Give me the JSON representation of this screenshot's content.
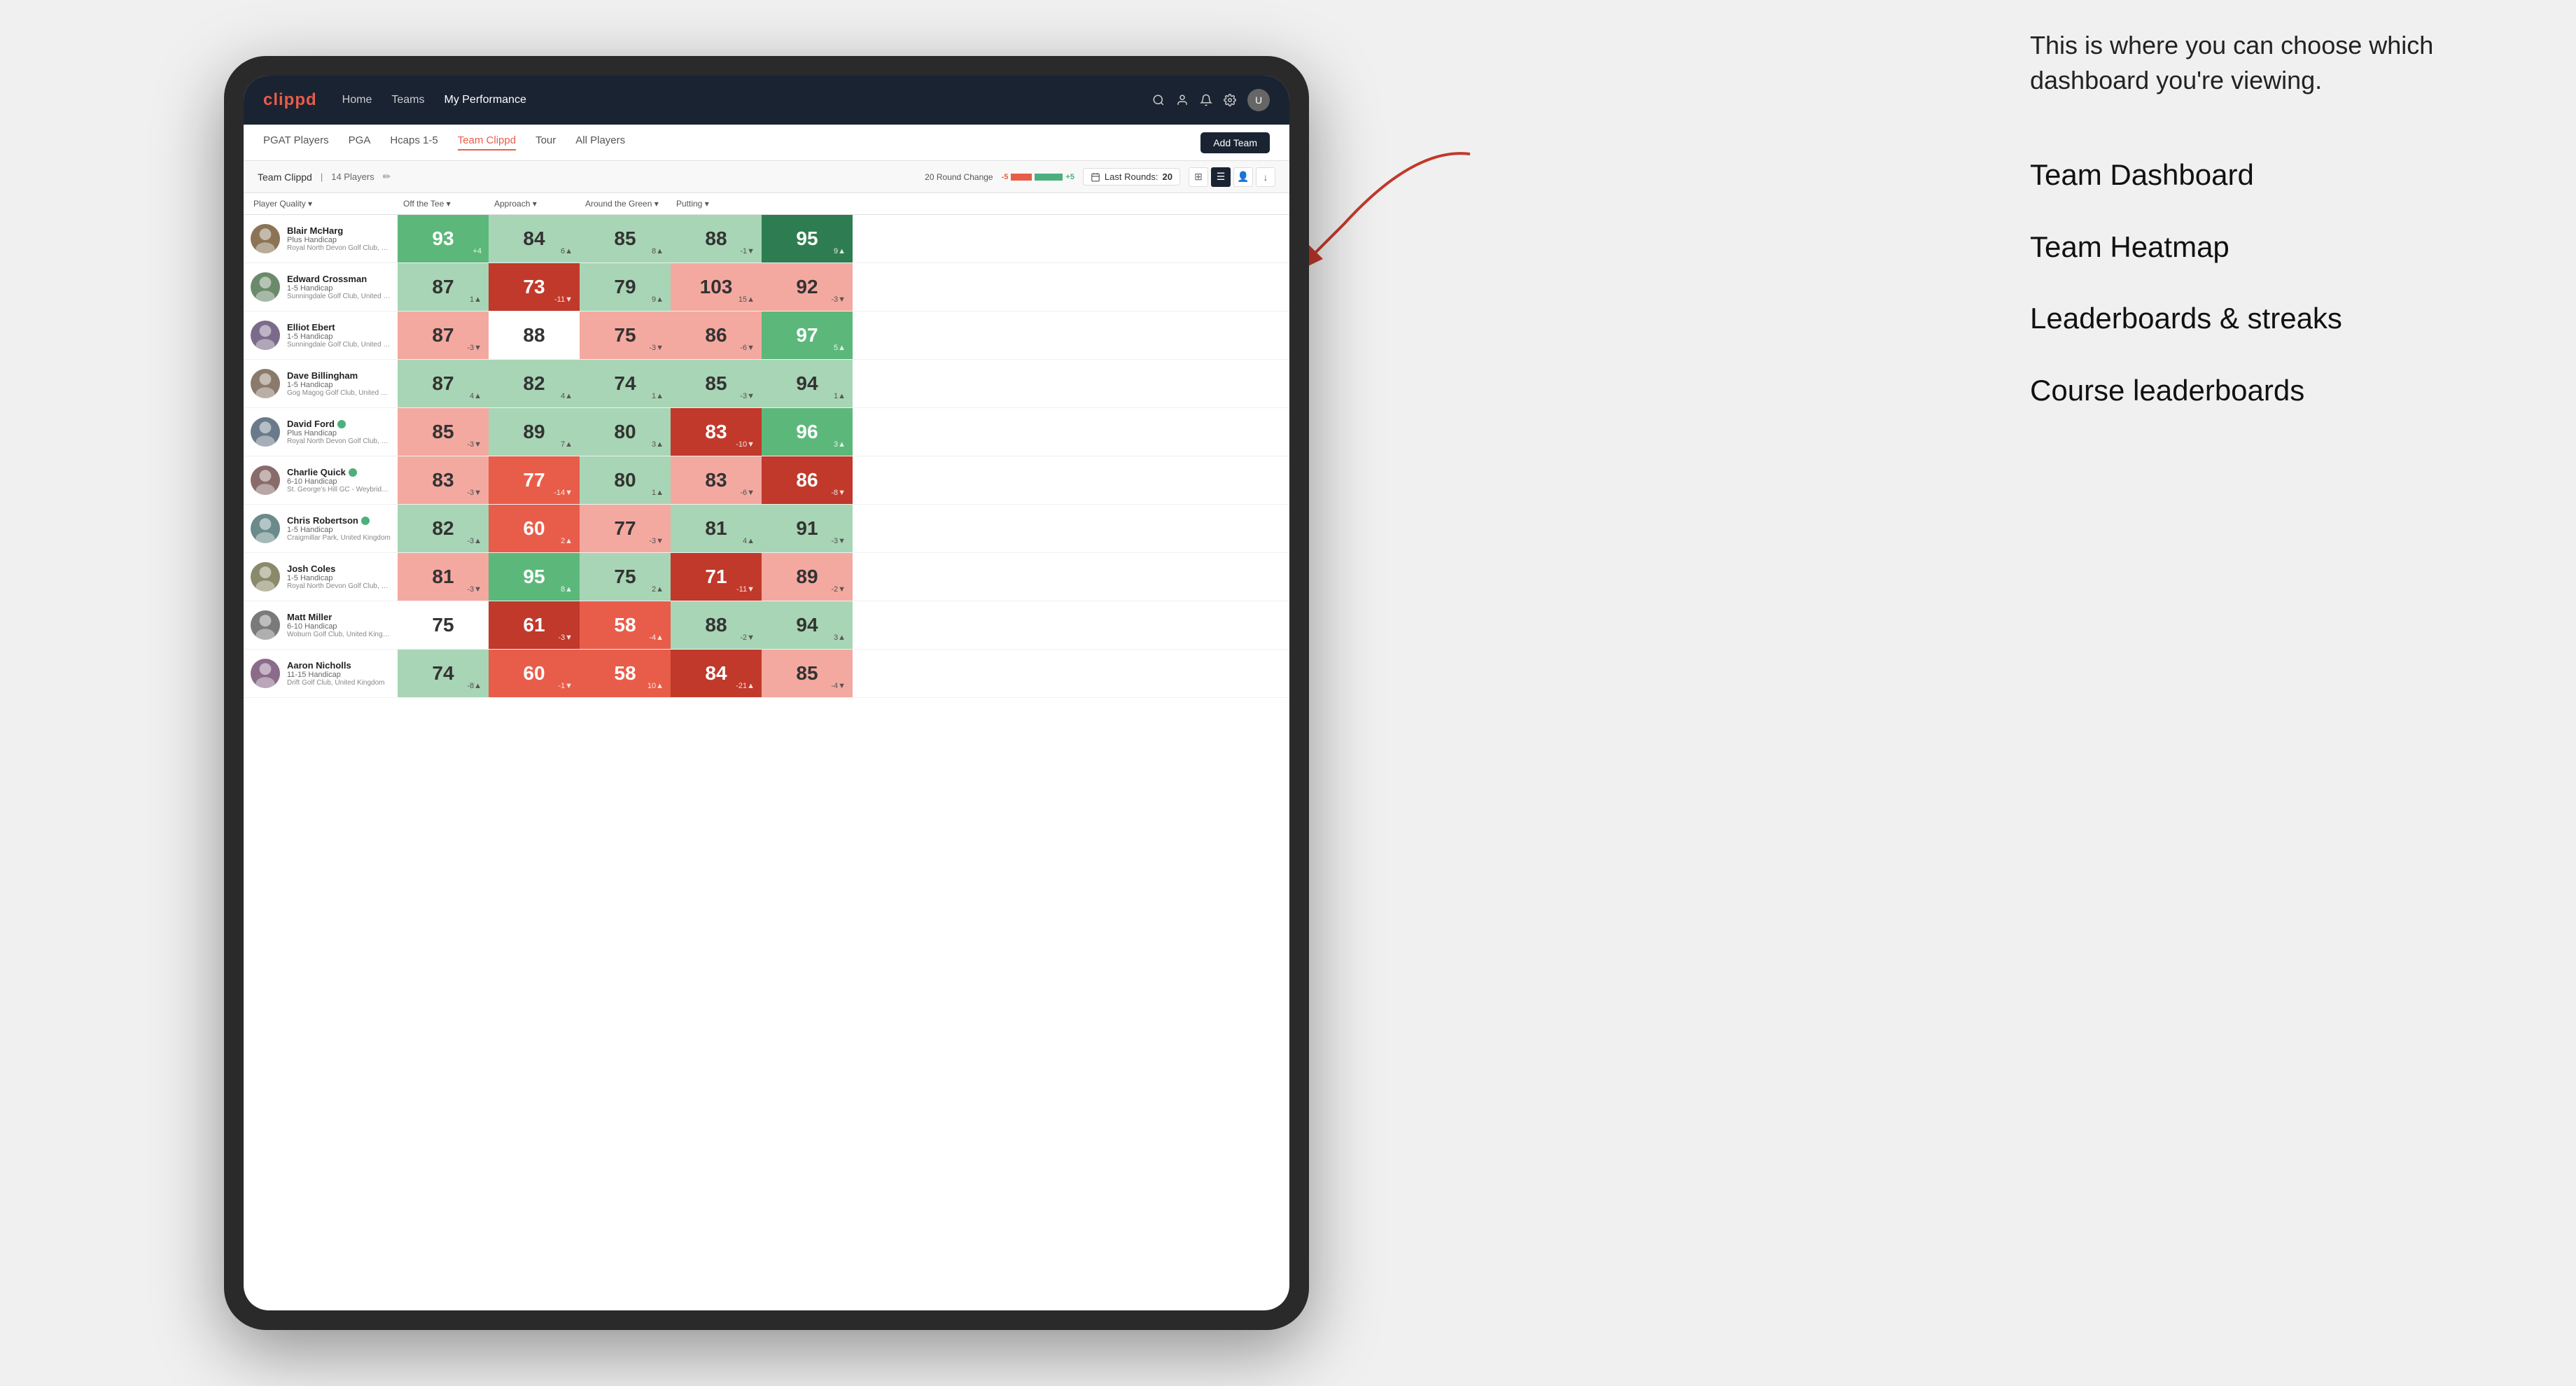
{
  "annotation": {
    "intro": "This is where you can choose which dashboard you're viewing.",
    "items": [
      "Team Dashboard",
      "Team Heatmap",
      "Leaderboards & streaks",
      "Course leaderboards"
    ]
  },
  "navbar": {
    "logo": "clippd",
    "links": [
      "Home",
      "Teams",
      "My Performance"
    ],
    "active_link": "My Performance"
  },
  "subnav": {
    "links": [
      "PGAT Players",
      "PGA",
      "Hcaps 1-5",
      "Team Clippd",
      "Tour",
      "All Players"
    ],
    "active": "Team Clippd",
    "add_button": "Add Team"
  },
  "team_bar": {
    "name": "Team Clippd",
    "count": "14 Players",
    "round_change_label": "20 Round Change",
    "change_minus": "-5",
    "change_plus": "+5",
    "last_rounds_label": "Last Rounds:",
    "last_rounds_value": "20"
  },
  "table": {
    "columns": [
      "Player Quality ▾",
      "Off the Tee ▾",
      "Approach ▾",
      "Around the Green ▾",
      "Putting ▾"
    ],
    "players": [
      {
        "name": "Blair McHarg",
        "handicap": "Plus Handicap",
        "club": "Royal North Devon Golf Club, United Kingdom",
        "verified": false,
        "scores": [
          {
            "value": 93,
            "change": "+4",
            "bg": "green-mid"
          },
          {
            "value": 84,
            "change": "6▲",
            "bg": "green-light"
          },
          {
            "value": 85,
            "change": "8▲",
            "bg": "green-light"
          },
          {
            "value": 88,
            "change": "-1▼",
            "bg": "green-light"
          },
          {
            "value": 95,
            "change": "9▲",
            "bg": "green-dark"
          }
        ]
      },
      {
        "name": "Edward Crossman",
        "handicap": "1-5 Handicap",
        "club": "Sunningdale Golf Club, United Kingdom",
        "verified": false,
        "scores": [
          {
            "value": 87,
            "change": "1▲",
            "bg": "green-light"
          },
          {
            "value": 73,
            "change": "-11▼",
            "bg": "red-dark"
          },
          {
            "value": 79,
            "change": "9▲",
            "bg": "green-light"
          },
          {
            "value": 103,
            "change": "15▲",
            "bg": "red-light"
          },
          {
            "value": 92,
            "change": "-3▼",
            "bg": "red-light"
          }
        ]
      },
      {
        "name": "Elliot Ebert",
        "handicap": "1-5 Handicap",
        "club": "Sunningdale Golf Club, United Kingdom",
        "verified": false,
        "scores": [
          {
            "value": 87,
            "change": "-3▼",
            "bg": "red-light"
          },
          {
            "value": 88,
            "change": "",
            "bg": "white"
          },
          {
            "value": 75,
            "change": "-3▼",
            "bg": "red-light"
          },
          {
            "value": 86,
            "change": "-6▼",
            "bg": "red-light"
          },
          {
            "value": 97,
            "change": "5▲",
            "bg": "green-mid"
          }
        ]
      },
      {
        "name": "Dave Billingham",
        "handicap": "1-5 Handicap",
        "club": "Gog Magog Golf Club, United Kingdom",
        "verified": false,
        "scores": [
          {
            "value": 87,
            "change": "4▲",
            "bg": "green-light"
          },
          {
            "value": 82,
            "change": "4▲",
            "bg": "green-light"
          },
          {
            "value": 74,
            "change": "1▲",
            "bg": "green-light"
          },
          {
            "value": 85,
            "change": "-3▼",
            "bg": "green-light"
          },
          {
            "value": 94,
            "change": "1▲",
            "bg": "green-light"
          }
        ]
      },
      {
        "name": "David Ford",
        "handicap": "Plus Handicap",
        "club": "Royal North Devon Golf Club, United Kingdom",
        "verified": true,
        "scores": [
          {
            "value": 85,
            "change": "-3▼",
            "bg": "red-light"
          },
          {
            "value": 89,
            "change": "7▲",
            "bg": "green-light"
          },
          {
            "value": 80,
            "change": "3▲",
            "bg": "green-light"
          },
          {
            "value": 83,
            "change": "-10▼",
            "bg": "red-dark"
          },
          {
            "value": 96,
            "change": "3▲",
            "bg": "green-mid"
          }
        ]
      },
      {
        "name": "Charlie Quick",
        "handicap": "6-10 Handicap",
        "club": "St. George's Hill GC - Weybridge - Surrey, Uni...",
        "verified": true,
        "scores": [
          {
            "value": 83,
            "change": "-3▼",
            "bg": "red-light"
          },
          {
            "value": 77,
            "change": "-14▼",
            "bg": "red-mid"
          },
          {
            "value": 80,
            "change": "1▲",
            "bg": "green-light"
          },
          {
            "value": 83,
            "change": "-6▼",
            "bg": "red-light"
          },
          {
            "value": 86,
            "change": "-8▼",
            "bg": "red-dark"
          }
        ]
      },
      {
        "name": "Chris Robertson",
        "handicap": "1-5 Handicap",
        "club": "Craigmillar Park, United Kingdom",
        "verified": true,
        "scores": [
          {
            "value": 82,
            "change": "-3▲",
            "bg": "green-light"
          },
          {
            "value": 60,
            "change": "2▲",
            "bg": "red-mid"
          },
          {
            "value": 77,
            "change": "-3▼",
            "bg": "red-light"
          },
          {
            "value": 81,
            "change": "4▲",
            "bg": "green-light"
          },
          {
            "value": 91,
            "change": "-3▼",
            "bg": "green-light"
          }
        ]
      },
      {
        "name": "Josh Coles",
        "handicap": "1-5 Handicap",
        "club": "Royal North Devon Golf Club, United Kingdom",
        "verified": false,
        "scores": [
          {
            "value": 81,
            "change": "-3▼",
            "bg": "red-light"
          },
          {
            "value": 95,
            "change": "8▲",
            "bg": "green-mid"
          },
          {
            "value": 75,
            "change": "2▲",
            "bg": "green-light"
          },
          {
            "value": 71,
            "change": "-11▼",
            "bg": "red-dark"
          },
          {
            "value": 89,
            "change": "-2▼",
            "bg": "red-light"
          }
        ]
      },
      {
        "name": "Matt Miller",
        "handicap": "6-10 Handicap",
        "club": "Woburn Golf Club, United Kingdom",
        "verified": false,
        "scores": [
          {
            "value": 75,
            "change": "",
            "bg": "white"
          },
          {
            "value": 61,
            "change": "-3▼",
            "bg": "red-dark"
          },
          {
            "value": 58,
            "change": "-4▲",
            "bg": "red-mid"
          },
          {
            "value": 88,
            "change": "-2▼",
            "bg": "green-light"
          },
          {
            "value": 94,
            "change": "3▲",
            "bg": "green-light"
          }
        ]
      },
      {
        "name": "Aaron Nicholls",
        "handicap": "11-15 Handicap",
        "club": "Drift Golf Club, United Kingdom",
        "verified": false,
        "scores": [
          {
            "value": 74,
            "change": "-8▲",
            "bg": "green-light"
          },
          {
            "value": 60,
            "change": "-1▼",
            "bg": "red-mid"
          },
          {
            "value": 58,
            "change": "10▲",
            "bg": "red-mid"
          },
          {
            "value": 84,
            "change": "-21▲",
            "bg": "red-dark"
          },
          {
            "value": 85,
            "change": "-4▼",
            "bg": "red-light"
          }
        ]
      }
    ]
  }
}
